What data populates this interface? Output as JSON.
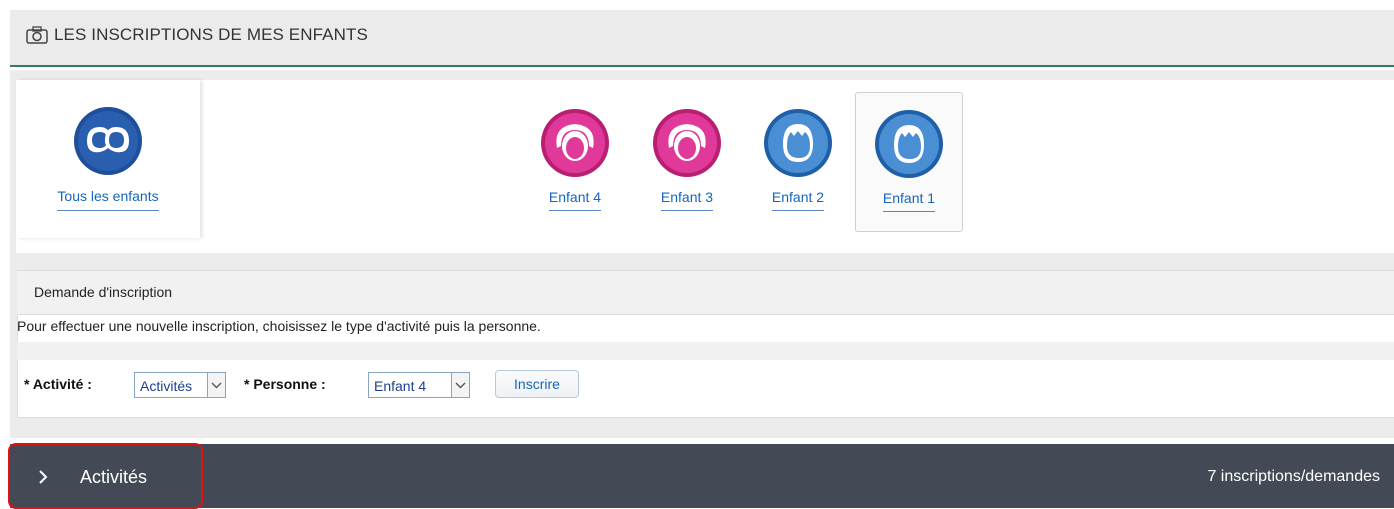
{
  "header": {
    "title": "LES INSCRIPTIONS DE MES ENFANTS",
    "icon": "camera-icon"
  },
  "children": {
    "all_label": "Tous les enfants",
    "items": [
      {
        "label": "Enfant 4",
        "gender": "girl",
        "color": "#e0399a",
        "selected": false
      },
      {
        "label": "Enfant 3",
        "gender": "girl",
        "color": "#e0399a",
        "selected": false
      },
      {
        "label": "Enfant 2",
        "gender": "boy",
        "color": "#4a8fd4",
        "selected": false
      },
      {
        "label": "Enfant 1",
        "gender": "boy",
        "color": "#4a8fd4",
        "selected": true
      }
    ]
  },
  "demande": {
    "title": "Demande d'inscription",
    "info": "Pour effectuer une nouvelle inscription, choisissez le type d'activité puis la personne.",
    "activite_label": "* Activité :",
    "activite_value": "Activités",
    "personne_label": "* Personne :",
    "personne_value": "Enfant 4",
    "submit_label": "Inscrire"
  },
  "activities_bar": {
    "label": "Activités",
    "count": "7 inscriptions/demandes"
  },
  "colors": {
    "accent": "#1565c0",
    "header_rule": "#2e7d5f",
    "bar_bg": "#444a55",
    "focus_ring": "#e31010"
  }
}
